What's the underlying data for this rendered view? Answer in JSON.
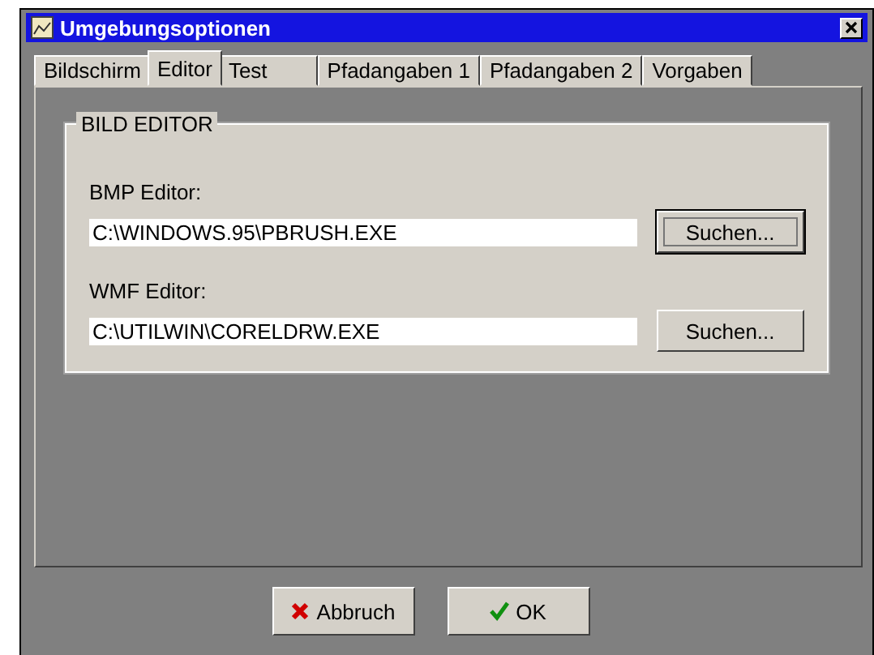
{
  "window": {
    "title": "Umgebungsoptionen"
  },
  "tabs": [
    {
      "label": "Bildschirm",
      "selected": false
    },
    {
      "label": "Editor",
      "selected": true
    },
    {
      "label": "Test",
      "selected": false
    },
    {
      "label": "Pfadangaben 1",
      "selected": false
    },
    {
      "label": "Pfadangaben 2",
      "selected": false
    },
    {
      "label": "Vorgaben",
      "selected": false
    }
  ],
  "group": {
    "title": "BILD EDITOR",
    "fields": [
      {
        "label": "BMP Editor:",
        "value": "C:\\WINDOWS.95\\PBRUSH.EXE",
        "button": "Suchen...",
        "focused": true
      },
      {
        "label": "WMF Editor:",
        "value": "C:\\UTILWIN\\CORELDRW.EXE",
        "button": "Suchen...",
        "focused": false
      }
    ]
  },
  "buttons": [
    {
      "label": "Abbruch",
      "kind": "cancel"
    },
    {
      "label": "OK",
      "kind": "ok"
    }
  ]
}
